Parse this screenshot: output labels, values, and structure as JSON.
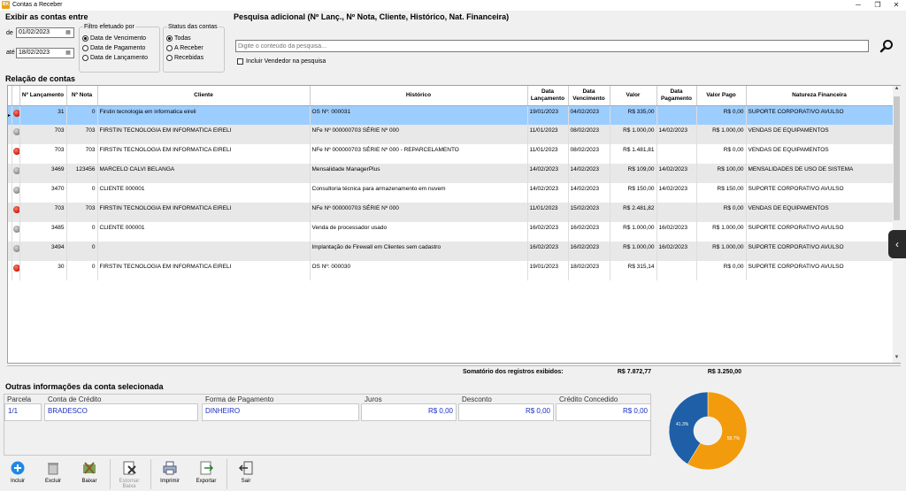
{
  "window": {
    "title": "Contas a Receber",
    "app_icon": "app-icon"
  },
  "filters": {
    "group_title": "Exibir as contas entre",
    "from_label": "de",
    "from_value": "01/02/2023",
    "to_label": "até",
    "to_value": "18/02/2023",
    "by_title": "Filtro efetuado por",
    "by_options": [
      "Data de Vencimento",
      "Data de Pagamento",
      "Data de Lançamento"
    ],
    "by_selected": 0,
    "status_title": "Status das contas",
    "status_options": [
      "Todas",
      "A Receber",
      "Recebidas"
    ],
    "status_selected": 0
  },
  "search": {
    "title": "Pesquisa adicional (Nº Lanç., Nº Nota, Cliente, Histórico, Nat. Financeira)",
    "placeholder": "Digite o conteúdo da pesquisa...",
    "include_seller_label": "Incluir Vendedor na pesquisa"
  },
  "accounts": {
    "title": "Relação de contas",
    "columns": [
      "Nº Lançamento",
      "Nº Nota",
      "Cliente",
      "Histórico",
      "Data Lançamento",
      "Data Vencimento",
      "Valor",
      "Data Pagamento",
      "Valor Pago",
      "Natureza Financeira"
    ],
    "rows": [
      {
        "status": "red",
        "lanc": "31",
        "nota": "0",
        "cliente": "Firstin tecnologia em informatica eireli",
        "historico": "OS Nº: 000031",
        "dlanc": "19/01/2023",
        "dvenc": "04/02/2023",
        "valor": "R$ 335,00",
        "dpag": "",
        "vpago": "R$ 0,00",
        "natureza": "SUPORTE CORPORATIVO AVULSO"
      },
      {
        "status": "gray",
        "lanc": "703",
        "nota": "703",
        "cliente": "FIRSTIN TECNOLOGIA EM INFORMATICA EIRELI",
        "historico": "NFe Nº 000000703 SÉRIE Nº 000",
        "dlanc": "11/01/2023",
        "dvenc": "08/02/2023",
        "valor": "R$ 1.000,00",
        "dpag": "14/02/2023",
        "vpago": "R$ 1.000,00",
        "natureza": "VENDAS DE EQUIPAMENTOS"
      },
      {
        "status": "red",
        "lanc": "703",
        "nota": "703",
        "cliente": "FIRSTIN TECNOLOGIA EM INFORMATICA EIRELI",
        "historico": "NFe Nº 000000703 SÉRIE Nº 000 - REPARCELAMENTO",
        "dlanc": "11/01/2023",
        "dvenc": "08/02/2023",
        "valor": "R$ 1.481,81",
        "dpag": "",
        "vpago": "R$ 0,00",
        "natureza": "VENDAS DE EQUIPAMENTOS"
      },
      {
        "status": "gray",
        "lanc": "3469",
        "nota": "123456",
        "cliente": "MARCELO CALVI BELANGA",
        "historico": "Mensalidade ManagerPlus",
        "dlanc": "14/02/2023",
        "dvenc": "14/02/2023",
        "valor": "R$ 109,00",
        "dpag": "14/02/2023",
        "vpago": "R$ 100,00",
        "natureza": "MENSALIDADES DE USO DE SISTEMA"
      },
      {
        "status": "gray",
        "lanc": "3470",
        "nota": "0",
        "cliente": "CLIENTE 000001",
        "historico": "Consultoria técnica para armazenamento em nuvem",
        "dlanc": "14/02/2023",
        "dvenc": "14/02/2023",
        "valor": "R$ 150,00",
        "dpag": "14/02/2023",
        "vpago": "R$ 150,00",
        "natureza": "SUPORTE CORPORATIVO AVULSO"
      },
      {
        "status": "red",
        "lanc": "703",
        "nota": "703",
        "cliente": "FIRSTIN TECNOLOGIA EM INFORMATICA EIRELI",
        "historico": "NFe Nº 000000703 SÉRIE Nº 000",
        "dlanc": "11/01/2023",
        "dvenc": "15/02/2023",
        "valor": "R$ 2.481,82",
        "dpag": "",
        "vpago": "R$ 0,00",
        "natureza": "VENDAS DE EQUIPAMENTOS"
      },
      {
        "status": "gray",
        "lanc": "3485",
        "nota": "0",
        "cliente": "CLIENTE 000001",
        "historico": "Venda de processador usado",
        "dlanc": "16/02/2023",
        "dvenc": "16/02/2023",
        "valor": "R$ 1.000,00",
        "dpag": "16/02/2023",
        "vpago": "R$ 1.000,00",
        "natureza": "SUPORTE CORPORATIVO AVULSO"
      },
      {
        "status": "gray",
        "lanc": "3494",
        "nota": "0",
        "cliente": "",
        "historico": "Implantação de Firewall em Clientes sem cadastro",
        "dlanc": "16/02/2023",
        "dvenc": "16/02/2023",
        "valor": "R$ 1.000,00",
        "dpag": "16/02/2023",
        "vpago": "R$ 1.000,00",
        "natureza": "SUPORTE CORPORATIVO AVULSO"
      },
      {
        "status": "red",
        "lanc": "30",
        "nota": "0",
        "cliente": "FIRSTIN TECNOLOGIA EM INFORMATICA EIRELI",
        "historico": "OS Nº: 000030",
        "dlanc": "19/01/2023",
        "dvenc": "18/02/2023",
        "valor": "R$ 315,14",
        "dpag": "",
        "vpago": "R$ 0,00",
        "natureza": "SUPORTE CORPORATIVO AVULSO"
      }
    ],
    "summary_label": "Somatório dos registros exibidos:",
    "summary_valor": "R$ 7.872,77",
    "summary_pago": "R$ 3.250,00"
  },
  "details": {
    "title": "Outras informações da conta selecionada",
    "parcela_label": "Parcela",
    "parcela": "1/1",
    "conta_label": "Conta de Crédito",
    "conta": "BRADESCO",
    "forma_label": "Forma de Pagamento",
    "forma": "DINHEIRO",
    "juros_label": "Juros",
    "juros": "R$ 0,00",
    "desconto_label": "Desconto",
    "desconto": "R$ 0,00",
    "credito_label": "Crédito Concedido",
    "credito": "R$ 0,00"
  },
  "donut": {
    "slices": [
      {
        "label": "58.7%",
        "value": 58.7,
        "color": "#f29b0c"
      },
      {
        "label": "41.3%",
        "value": 41.3,
        "color": "#1f5fa8"
      }
    ]
  },
  "toolbar": {
    "incluir": "Incluir",
    "excluir": "Excluir",
    "baixar": "Baixar",
    "estornar": "Estornar Baixa",
    "imprimir": "Imprimir",
    "exportar": "Exportar",
    "sair": "Sair"
  }
}
